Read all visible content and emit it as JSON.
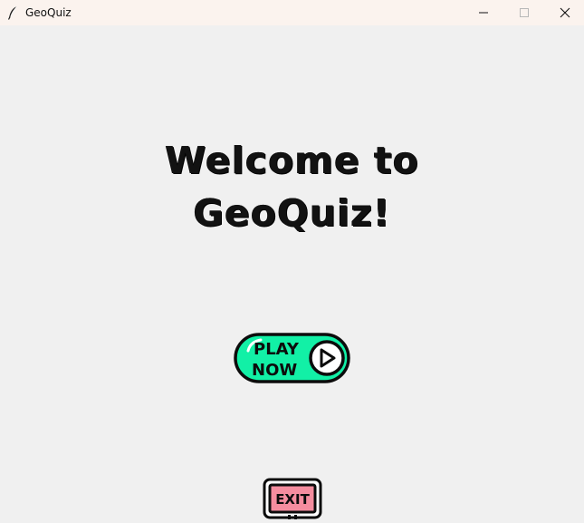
{
  "window": {
    "title": "GeoQuiz",
    "app_icon": "feather-icon",
    "controls": {
      "minimize_icon": "minimize-icon",
      "maximize_icon": "maximize-icon",
      "close_icon": "close-icon"
    }
  },
  "main": {
    "welcome_line1": "Welcome to",
    "welcome_line2": "GeoQuiz!"
  },
  "play_button": {
    "line1": "PLAY",
    "line2": "NOW",
    "icon": "play-circle-icon",
    "fill_color": "#12f0a6"
  },
  "exit_button": {
    "label": "EXIT",
    "fill_color": "#f58d9f"
  }
}
